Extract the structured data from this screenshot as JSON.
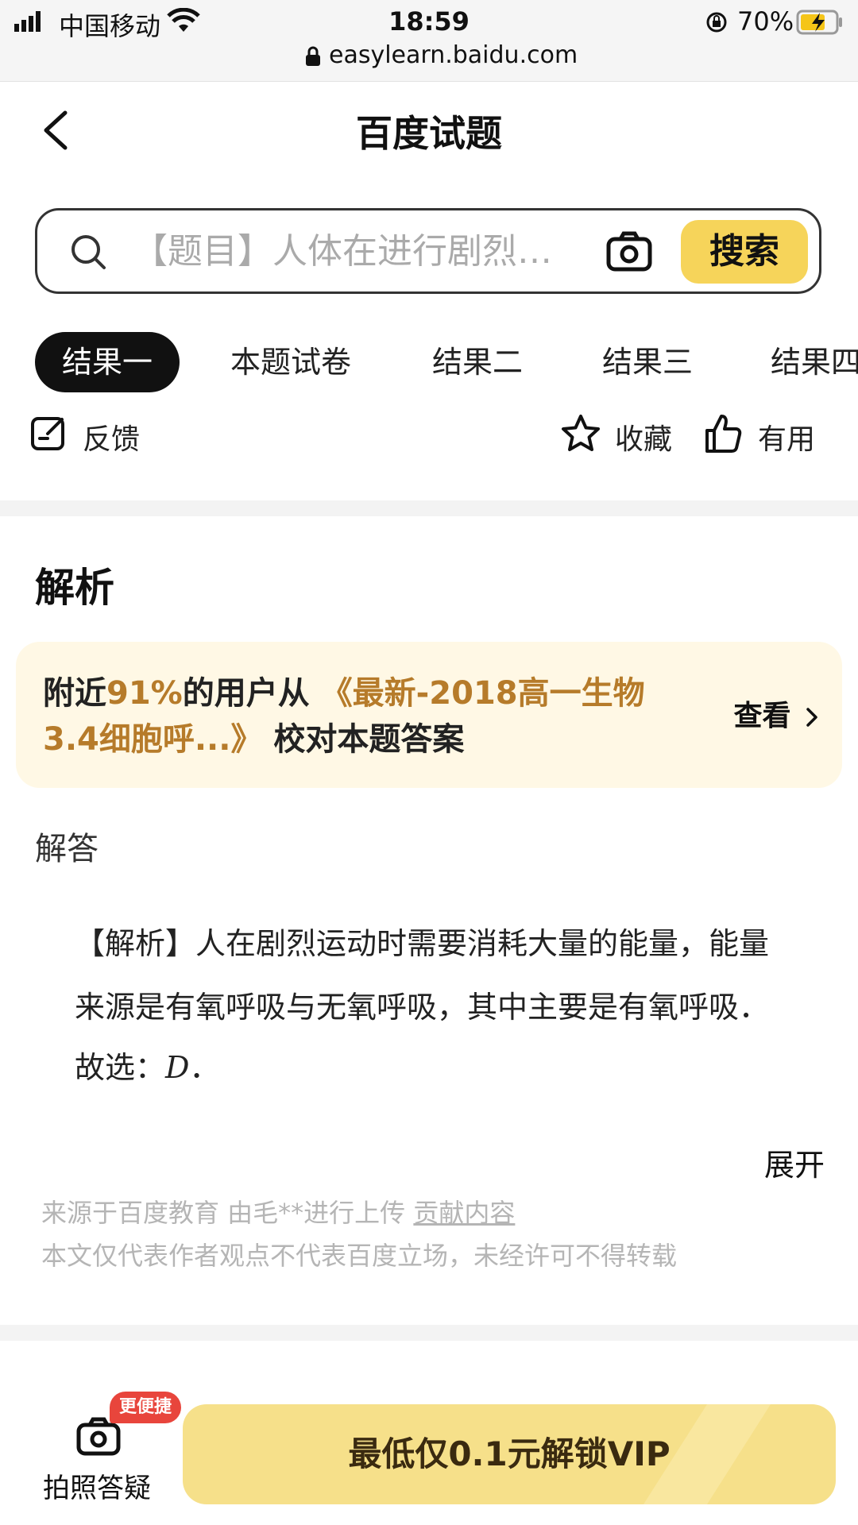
{
  "status_bar": {
    "carrier": "中国移动",
    "time": "18:59",
    "battery": "70%",
    "url": "easylearn.baidu.com"
  },
  "header": {
    "title": "百度试题"
  },
  "search": {
    "placeholder": "【题目】人体在进行剧烈…",
    "button_label": "搜索"
  },
  "tabs": [
    {
      "label": "结果一",
      "active": true
    },
    {
      "label": "本题试卷",
      "active": false
    },
    {
      "label": "结果二",
      "active": false
    },
    {
      "label": "结果三",
      "active": false
    },
    {
      "label": "结果四",
      "active": false
    }
  ],
  "actions": {
    "feedback": "反馈",
    "favorite": "收藏",
    "useful": "有用"
  },
  "analysis": {
    "heading": "解析",
    "notice": {
      "prefix": "附近",
      "percent": "91%",
      "middle": "的用户从 ",
      "source_title": "《最新-2018高一生物3.4细胞呼...》",
      "suffix": " 校对本题答案",
      "view_label": "查看"
    },
    "answer_label": "解答",
    "answer_text": "【解析】人在剧烈运动时需要消耗大量的能量，能量来源是有氧呼吸与无氧呼吸，其中主要是有氧呼吸．",
    "answer_choice_prefix": "故选：",
    "answer_choice": "D",
    "answer_choice_suffix": "．",
    "expand_label": "展开",
    "source_line_prefix": "来源于百度教育 由毛**进行上传 ",
    "source_line_link": "贡献内容",
    "disclaimer": "本文仅代表作者观点不代表百度立场，未经许可不得转载"
  },
  "bottom": {
    "photo_label": "拍照答疑",
    "badge": "更便捷",
    "vip_label": "最低仅0.1元解锁VIP"
  },
  "colors": {
    "accent_yellow": "#f6d45a",
    "notice_bg": "#fff8e5",
    "orange_text": "#b67b2a",
    "badge_red": "#e8453c"
  }
}
